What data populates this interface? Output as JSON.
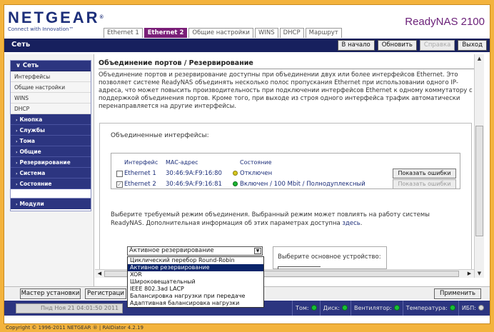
{
  "header": {
    "brand": "NETGEAR",
    "brand_mark": "®",
    "slogan": "Connect with Innovation™",
    "product": "ReadyNAS 2100"
  },
  "tabs": [
    "Ethernet 1",
    "Ethernet 2",
    "Общие настройки",
    "WINS",
    "DHCP",
    "Маршрут"
  ],
  "active_tab": "Ethernet 2",
  "navbar": {
    "title": "Сеть",
    "buttons": {
      "home": "В начало",
      "refresh": "Обновить",
      "help": "Справка",
      "logout": "Выход"
    }
  },
  "sidebar": {
    "head": "Сеть",
    "subitems": [
      "Интерфейсы",
      "Общие настройки",
      "WINS",
      "DHCP"
    ],
    "groups": [
      "Кнопка",
      "Службы",
      "Тома",
      "Общие",
      "Резервирование",
      "Система",
      "Состояние"
    ],
    "modules": "Модули"
  },
  "content": {
    "title": "Объединение портов / Резервирование",
    "description": "Объединение портов и резервирование доступны при объединении двух или более интерфейсов Ethernet. Это позволяет системе ReadyNAS объединять несколько полос пропускания Ethernet при использовании одного IP-адреса, что может повысить производительность при подключении интерфейсов Ethernet к одному коммутатору с поддержкой объединения портов. Кроме того, при выходе из строя одного интерфейса трафик автоматически перенаправляется на другие интерфейсы.",
    "bonded_label": "Объединенные интерфейсы:",
    "table": {
      "headers": {
        "interface": "Интерфейс",
        "mac": "MAC-адрес",
        "state": "Состояние"
      },
      "rows": [
        {
          "interface": "Ethernet 1",
          "mac": "30:46:9A:F9:16:80",
          "state": "Отключен",
          "led": "yellow",
          "button": "Показать ошибки",
          "checked": false
        },
        {
          "interface": "Ethernet 2",
          "mac": "30:46:9A:F9:16:81",
          "state": "Включен / 100 Mbit / Полнодуплексный",
          "led": "green",
          "button": "Показать ошибки",
          "checked": true
        }
      ]
    },
    "mode_text": "Выберите требуемый режим объединения. Выбранный режим может повлиять на работу системы ReadyNAS. Дополнительная информация об этих параметрах доступна",
    "mode_link": "здесь",
    "mode_text_end": ".",
    "primary_device_label": "Выберите основное устройство:"
  },
  "dropdown": {
    "selected": "Активное резервирование",
    "options": [
      "Циклический перебор Round-Robin",
      "Активное резервирование",
      "XOR",
      "Широковещательный",
      "IEEE 802.3ad LACP",
      "Балансировка нагрузки при передаче",
      "Адаптивная балансировка нагрузки"
    ],
    "highlighted_index": 1
  },
  "bottom": {
    "wizard": "Мастер установки",
    "register": "Регистраци",
    "apply": "Применить"
  },
  "status": {
    "datetime": "Пнд Ноя 21  04:01:50 2011",
    "indicators": [
      {
        "label": "Том:",
        "state": "ok"
      },
      {
        "label": "Диск:",
        "state": "ok"
      },
      {
        "label": "Вентилятор:",
        "state": "ok"
      },
      {
        "label": "Температура:",
        "state": "ok"
      },
      {
        "label": "ИБП:",
        "state": "off"
      }
    ]
  },
  "copyright": "Copyright © 1996-2011 NETGEAR ® | RAIDiator 4.2.19",
  "colors": {
    "frame": "#f3b33d",
    "navy": "#17205e",
    "accent_purple": "#7a1f78",
    "led_green": "#1bb531",
    "led_yellow": "#d6c71d"
  }
}
